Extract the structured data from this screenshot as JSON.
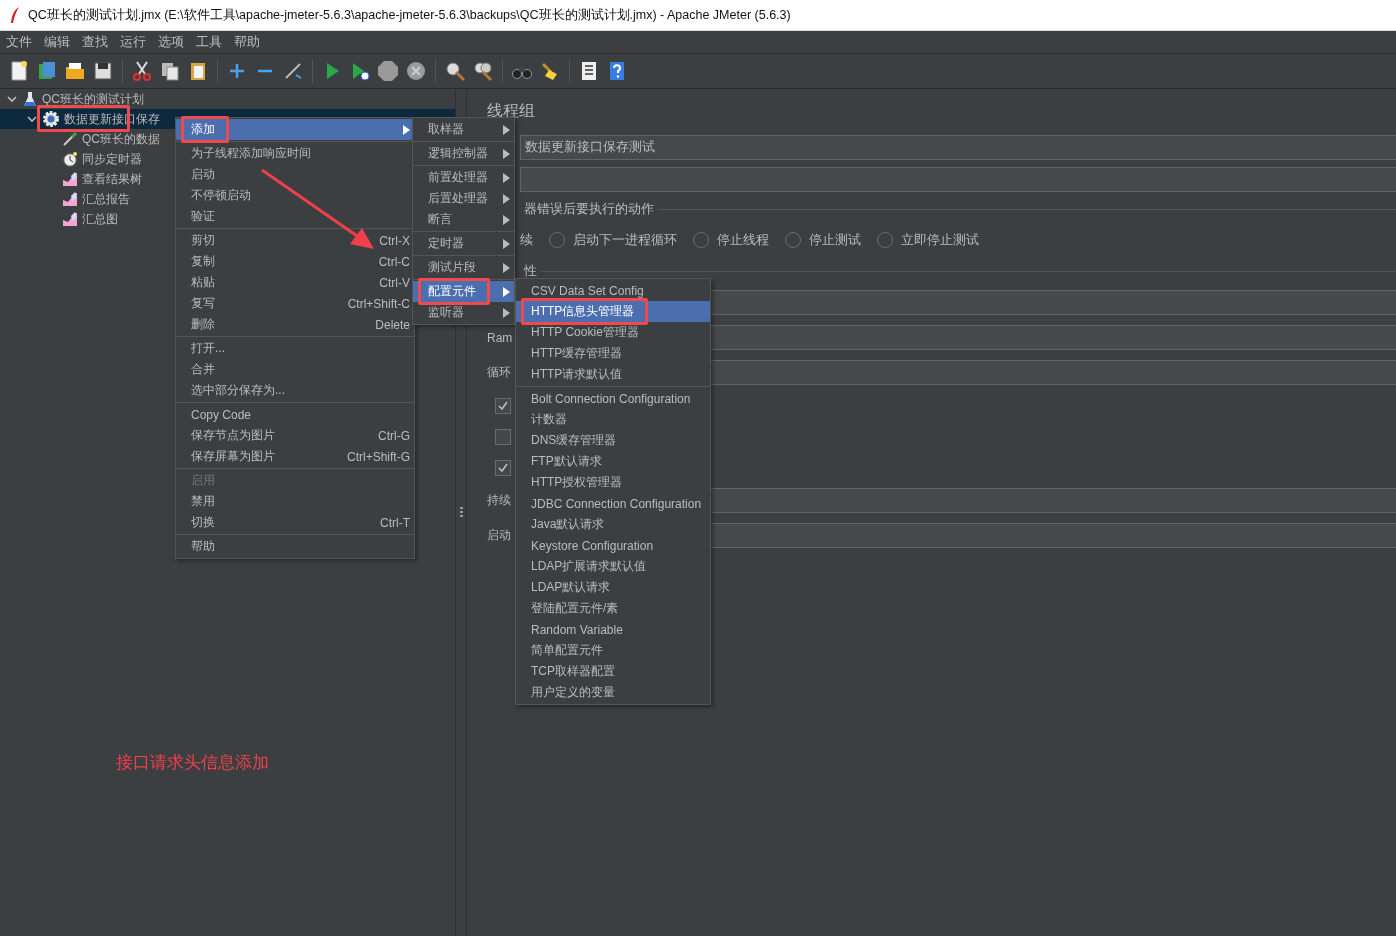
{
  "window": {
    "title": "QC班长的测试计划.jmx (E:\\软件工具\\apache-jmeter-5.6.3\\apache-jmeter-5.6.3\\backups\\QC班长的测试计划.jmx) - Apache JMeter (5.6.3)"
  },
  "menu_bar": [
    "文件",
    "编辑",
    "查找",
    "运行",
    "选项",
    "工具",
    "帮助"
  ],
  "tree": [
    {
      "label": "QC班长的测试计划",
      "kind": "plan",
      "expanded": true,
      "selected": false,
      "children": [
        {
          "label": "数据更新接口保存",
          "kind": "thread_group",
          "expanded": true,
          "selected": true,
          "annotated": true,
          "children": [
            {
              "label": "QC班长的数据",
              "kind": "sampler",
              "selected": false
            },
            {
              "label": "同步定时器",
              "kind": "timer",
              "selected": false
            },
            {
              "label": "查看结果树",
              "kind": "listener",
              "selected": false
            },
            {
              "label": "汇总报告",
              "kind": "listener",
              "selected": false
            },
            {
              "label": "汇总图",
              "kind": "listener",
              "selected": false
            }
          ]
        }
      ]
    }
  ],
  "editor": {
    "title": "线程组",
    "name_value": "数据更新接口保存测试",
    "error_section": "器错误后要执行的动作",
    "error_actions": [
      {
        "label": "续",
        "kind": "text"
      },
      {
        "label": "启动下一进程循环",
        "selected": false,
        "kind": "radio"
      },
      {
        "label": "停止线程",
        "selected": false,
        "kind": "radio"
      },
      {
        "label": "停止测试",
        "selected": false,
        "kind": "radio"
      },
      {
        "label": "立即停止测试",
        "selected": false,
        "kind": "radio"
      }
    ],
    "properties_section": "性",
    "rows": [
      {
        "kind": "field"
      },
      {
        "kind": "field",
        "label": "Ram"
      },
      {
        "kind": "field",
        "label": "循环"
      },
      {
        "kind": "checkbox",
        "checked": true
      },
      {
        "kind": "checkbox",
        "checked": false
      },
      {
        "kind": "checkbox",
        "checked": true
      },
      {
        "kind": "field",
        "label": "持续"
      },
      {
        "kind": "field",
        "label": "启动"
      }
    ]
  },
  "context_menu": {
    "items": [
      {
        "kind": "item",
        "label": "添加",
        "submenu": true,
        "selected": true,
        "disabled": false,
        "annotated": true
      },
      {
        "kind": "separator"
      },
      {
        "kind": "item",
        "label": "为子线程添加响应时间",
        "selected": false,
        "disabled": false
      },
      {
        "kind": "item",
        "label": "启动",
        "selected": false,
        "disabled": false
      },
      {
        "kind": "item",
        "label": "不停顿启动",
        "selected": false,
        "disabled": false
      },
      {
        "kind": "item",
        "label": "验证",
        "selected": false,
        "disabled": false
      },
      {
        "kind": "separator"
      },
      {
        "kind": "item",
        "label": "剪切",
        "shortcut": "Ctrl-X",
        "selected": false,
        "disabled": false
      },
      {
        "kind": "item",
        "label": "复制",
        "shortcut": "Ctrl-C",
        "selected": false,
        "disabled": false
      },
      {
        "kind": "item",
        "label": "粘贴",
        "shortcut": "Ctrl-V",
        "selected": false,
        "disabled": false
      },
      {
        "kind": "item",
        "label": "复写",
        "shortcut": "Ctrl+Shift-C",
        "selected": false,
        "disabled": false
      },
      {
        "kind": "item",
        "label": "删除",
        "shortcut": "Delete",
        "selected": false,
        "disabled": false
      },
      {
        "kind": "separator"
      },
      {
        "kind": "item",
        "label": "打开...",
        "selected": false,
        "disabled": false
      },
      {
        "kind": "item",
        "label": "合并",
        "selected": false,
        "disabled": false
      },
      {
        "kind": "item",
        "label": "选中部分保存为...",
        "selected": false,
        "disabled": false
      },
      {
        "kind": "separator"
      },
      {
        "kind": "item",
        "label": "Copy Code",
        "selected": false,
        "disabled": false
      },
      {
        "kind": "item",
        "label": "保存节点为图片",
        "shortcut": "Ctrl-G",
        "selected": false,
        "disabled": false
      },
      {
        "kind": "item",
        "label": "保存屏幕为图片",
        "shortcut": "Ctrl+Shift-G",
        "selected": false,
        "disabled": false
      },
      {
        "kind": "separator"
      },
      {
        "kind": "item",
        "label": "启用",
        "selected": false,
        "disabled": true
      },
      {
        "kind": "item",
        "label": "禁用",
        "selected": false,
        "disabled": false
      },
      {
        "kind": "item",
        "label": "切换",
        "shortcut": "Ctrl-T",
        "selected": false,
        "disabled": false
      },
      {
        "kind": "separator"
      },
      {
        "kind": "item",
        "label": "帮助",
        "selected": false,
        "disabled": false
      }
    ]
  },
  "add_submenu": {
    "items": [
      {
        "kind": "item",
        "label": "取样器",
        "submenu": true,
        "selected": false
      },
      {
        "kind": "separator"
      },
      {
        "kind": "item",
        "label": "逻辑控制器",
        "submenu": true,
        "selected": false
      },
      {
        "kind": "separator"
      },
      {
        "kind": "item",
        "label": "前置处理器",
        "submenu": true,
        "selected": false
      },
      {
        "kind": "item",
        "label": "后置处理器",
        "submenu": true,
        "selected": false
      },
      {
        "kind": "item",
        "label": "断言",
        "submenu": true,
        "selected": false
      },
      {
        "kind": "separator"
      },
      {
        "kind": "item",
        "label": "定时器",
        "submenu": true,
        "selected": false
      },
      {
        "kind": "separator"
      },
      {
        "kind": "item",
        "label": "测试片段",
        "submenu": true,
        "selected": false
      },
      {
        "kind": "separator"
      },
      {
        "kind": "item",
        "label": "配置元件",
        "submenu": true,
        "selected": true,
        "annotated": true
      },
      {
        "kind": "item",
        "label": "监听器",
        "submenu": true,
        "selected": false
      }
    ]
  },
  "config_submenu": {
    "items": [
      {
        "kind": "item",
        "label": "CSV Data Set Config",
        "selected": false
      },
      {
        "kind": "item",
        "label": "HTTP信息头管理器",
        "selected": true,
        "annotated": true
      },
      {
        "kind": "item",
        "label": "HTTP Cookie管理器",
        "selected": false
      },
      {
        "kind": "item",
        "label": "HTTP缓存管理器",
        "selected": false
      },
      {
        "kind": "item",
        "label": "HTTP请求默认值",
        "selected": false
      },
      {
        "kind": "separator"
      },
      {
        "kind": "item",
        "label": "Bolt Connection Configuration",
        "selected": false
      },
      {
        "kind": "item",
        "label": "计数器",
        "selected": false
      },
      {
        "kind": "item",
        "label": "DNS缓存管理器",
        "selected": false
      },
      {
        "kind": "item",
        "label": "FTP默认请求",
        "selected": false
      },
      {
        "kind": "item",
        "label": "HTTP授权管理器",
        "selected": false
      },
      {
        "kind": "item",
        "label": "JDBC Connection Configuration",
        "selected": false
      },
      {
        "kind": "item",
        "label": "Java默认请求",
        "selected": false
      },
      {
        "kind": "item",
        "label": "Keystore Configuration",
        "selected": false
      },
      {
        "kind": "item",
        "label": "LDAP扩展请求默认值",
        "selected": false
      },
      {
        "kind": "item",
        "label": "LDAP默认请求",
        "selected": false
      },
      {
        "kind": "item",
        "label": "登陆配置元件/素",
        "selected": false
      },
      {
        "kind": "item",
        "label": "Random Variable",
        "selected": false
      },
      {
        "kind": "item",
        "label": "简单配置元件",
        "selected": false
      },
      {
        "kind": "item",
        "label": "TCP取样器配置",
        "selected": false
      },
      {
        "kind": "item",
        "label": "用户定义的变量",
        "selected": false
      }
    ]
  },
  "annotation": {
    "caption": "接口请求头信息添加"
  }
}
